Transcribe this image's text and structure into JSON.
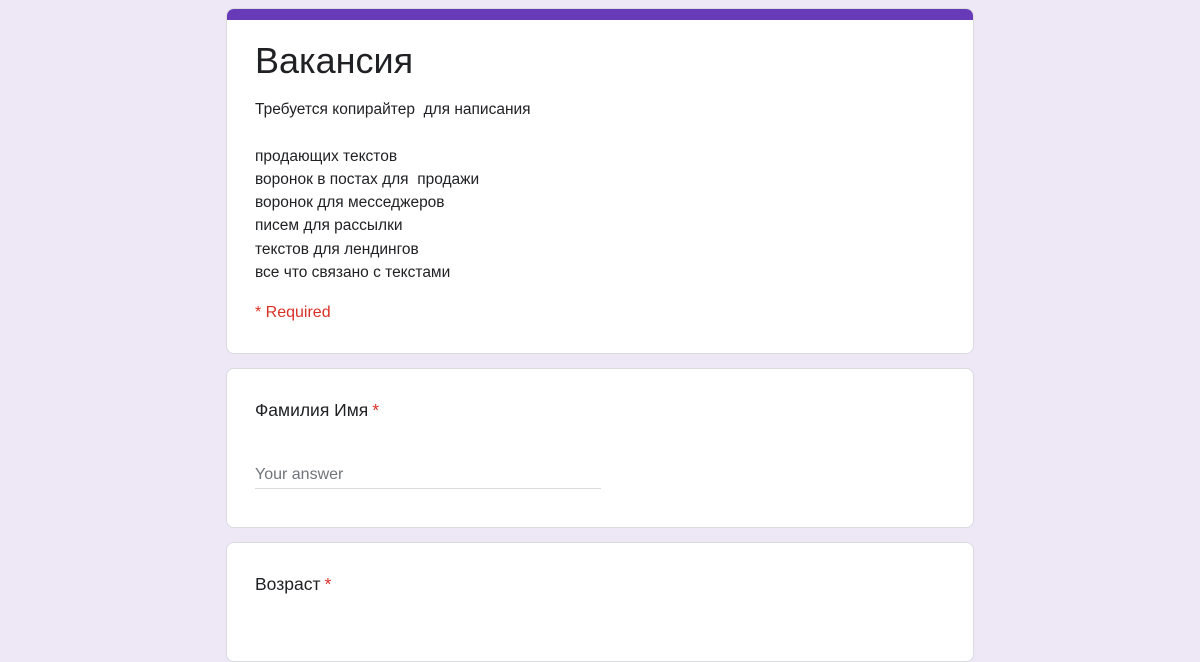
{
  "form": {
    "title": "Вакансия",
    "description": "Требуется копирайтер  для написания\n\nпродающих текстов\nворонок в постах для  продажи\nворонок для месседжеров\nписем для рассылки\nтекстов для лендингов\nвсе что связано с текстами",
    "required_note": "* Required",
    "accent_color": "#673ab7",
    "background_color": "#ede7f6",
    "required_color": "#d93025"
  },
  "questions": [
    {
      "title": "Фамилия Имя",
      "required_mark": "*",
      "placeholder": "Your answer",
      "value": ""
    },
    {
      "title": "Возраст",
      "required_mark": "*"
    }
  ]
}
